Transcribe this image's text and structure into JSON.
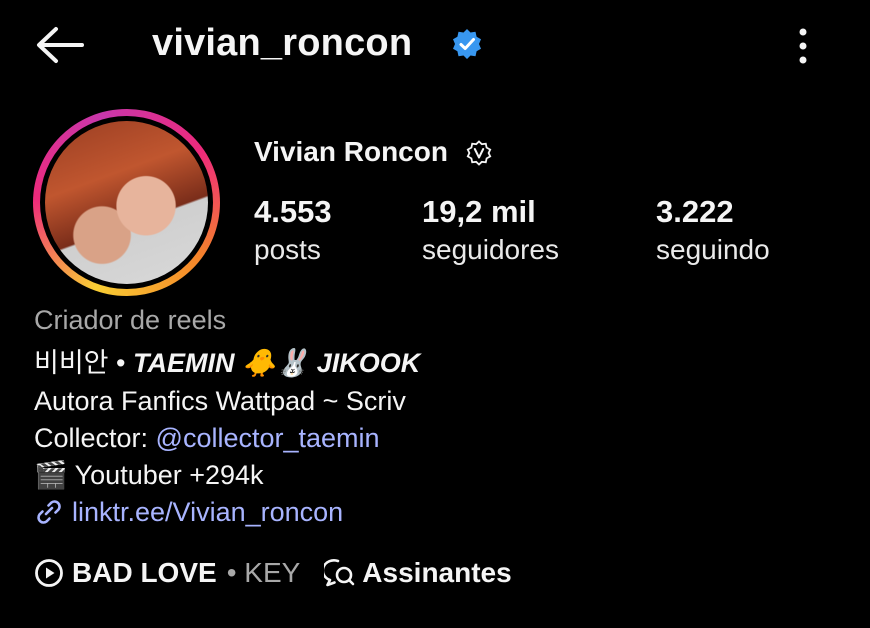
{
  "header": {
    "username": "vivian_roncon",
    "back_icon": "arrow-left-icon",
    "verified_icon": "verified-badge-icon",
    "menu_icon": "more-vertical-icon"
  },
  "profile": {
    "full_name": "Vivian Roncon",
    "meta_badge_icon": "meta-verified-icon",
    "stats": [
      {
        "value": "4.553",
        "label": "posts"
      },
      {
        "value": "19,2 mil",
        "label": "seguidores"
      },
      {
        "value": "3.222",
        "label": "seguindo"
      }
    ],
    "category": "Criador de reels",
    "bio": {
      "line1_prefix": "비비안 • ",
      "line1_bold": "TAEMIN 🐥🐰 JIKOOK",
      "line2": "Autora Fanfics Wattpad ~ Scriv",
      "line3_prefix": "Collector: ",
      "line3_mention": "@collector_taemin",
      "line4": "🎬 Youtuber +294k",
      "link": "linktr.ee/Vivian_roncon",
      "link_icon": "link-icon"
    },
    "music": {
      "play_icon": "play-circle-icon",
      "song": "BAD LOVE",
      "artist": "• KEY"
    },
    "threads": {
      "icon": "threads-icon",
      "label": "Assinantes"
    }
  },
  "colors": {
    "background": "#000000",
    "text": "#f5f5f5",
    "muted": "#a8a8a8",
    "link": "#a8b4ff",
    "verified_blue": "#3897f0"
  }
}
